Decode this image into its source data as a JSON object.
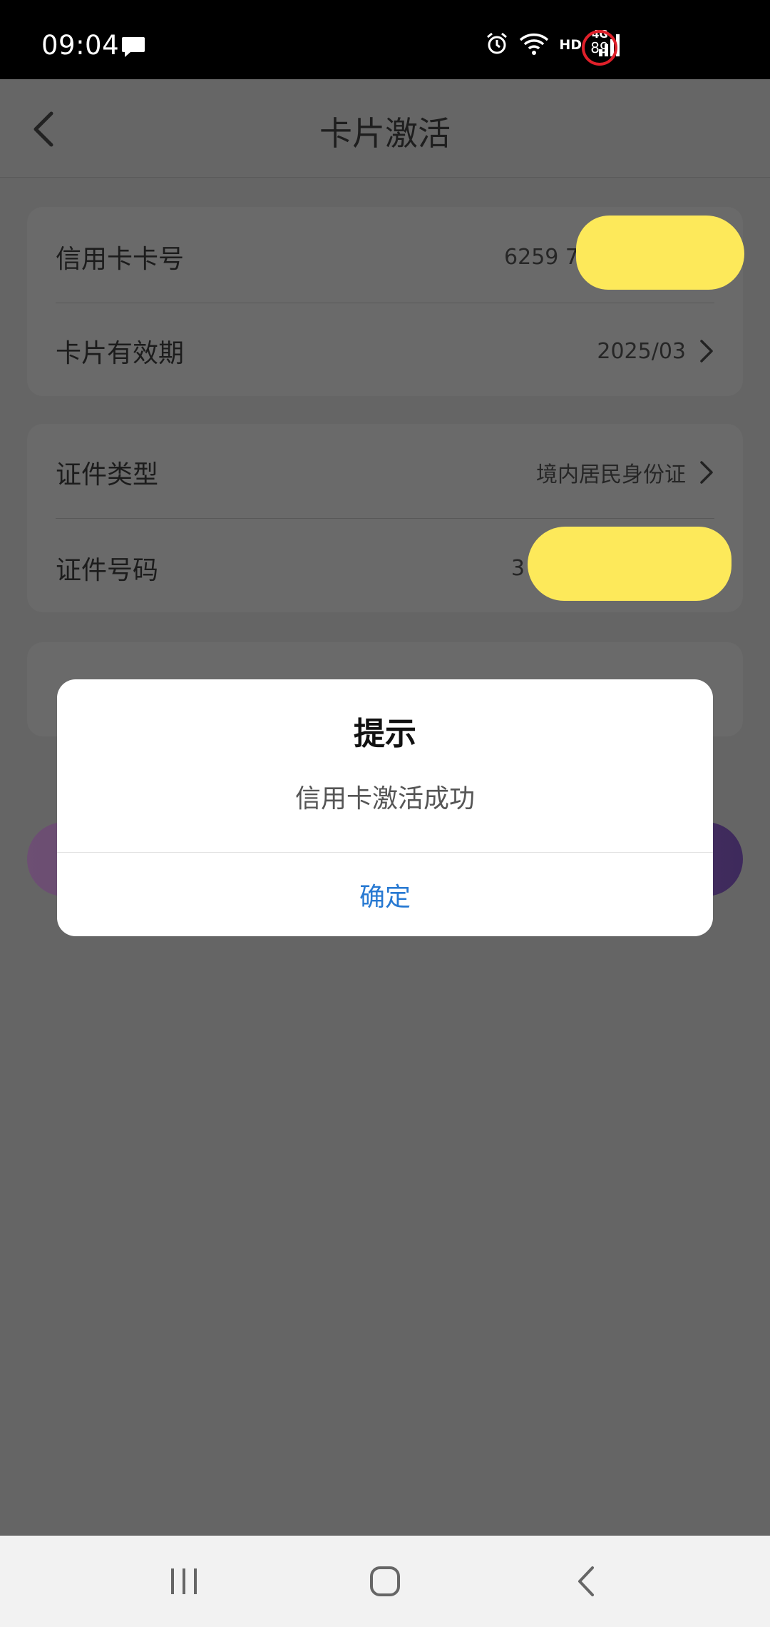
{
  "status_bar": {
    "time": "09:04",
    "network_label": "HD",
    "network_type": "4G",
    "battery_level": "89",
    "icons": [
      "message-icon",
      "alarm-icon",
      "wifi-icon",
      "signal-icon",
      "battery-ring-icon"
    ]
  },
  "header": {
    "title": "卡片激活",
    "back_icon": "chevron-left-icon"
  },
  "card_section": {
    "rows": [
      {
        "label": "信用卡卡号",
        "value": "6259 7"
      },
      {
        "label": "卡片有效期",
        "value": "2025/03"
      }
    ]
  },
  "id_section": {
    "rows": [
      {
        "label": "证件类型",
        "value": "境内居民身份证"
      },
      {
        "label": "证件号码",
        "value": "3"
      }
    ]
  },
  "colors": {
    "overlay": "#656565",
    "dialog_bg": "#ffffff",
    "confirm_text": "#2779d2",
    "redaction": "#fde95a",
    "battery_ring": "#e0202a"
  },
  "dialog": {
    "title": "提示",
    "message": "信用卡激活成功",
    "confirm_label": "确定"
  },
  "nav_bar": {
    "icons": [
      "recent-apps-icon",
      "home-icon",
      "back-icon"
    ]
  }
}
